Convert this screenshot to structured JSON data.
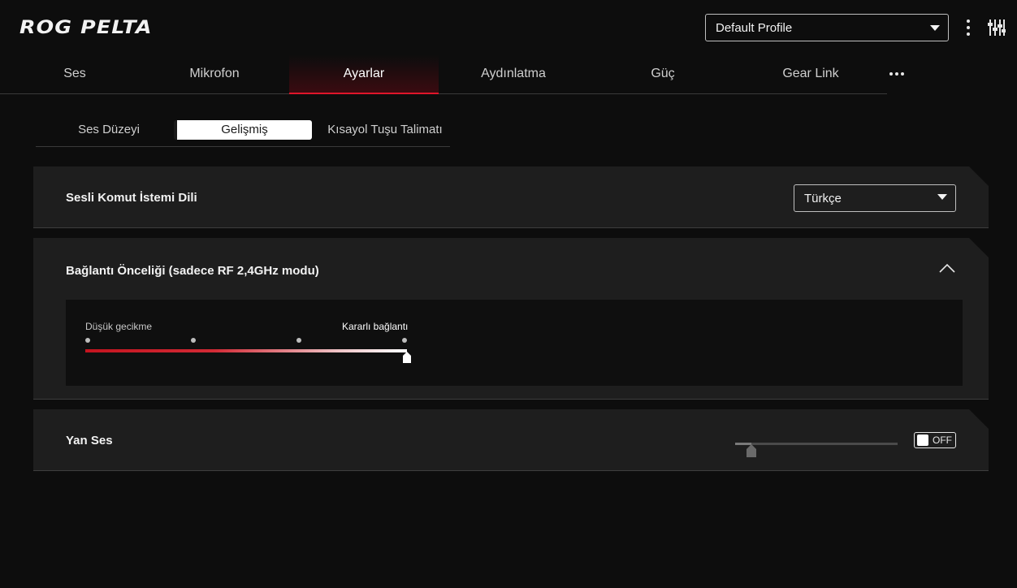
{
  "header": {
    "logo": "ROG PELTA",
    "profile": "Default Profile"
  },
  "tabs": [
    {
      "label": "Ses",
      "active": false
    },
    {
      "label": "Mikrofon",
      "active": false
    },
    {
      "label": "Ayarlar",
      "active": true
    },
    {
      "label": "Aydınlatma",
      "active": false
    },
    {
      "label": "Güç",
      "active": false
    },
    {
      "label": "Gear Link",
      "active": false
    }
  ],
  "subtabs": [
    {
      "label": "Ses Düzeyi",
      "active": false
    },
    {
      "label": "Gelişmiş",
      "active": true
    },
    {
      "label": "Kısayol Tuşu Talimatı",
      "active": false
    }
  ],
  "voice_prompt": {
    "title": "Sesli Komut İstemi Dili",
    "selected": "Türkçe"
  },
  "connection_priority": {
    "title": "Bağlantı Önceliği (sadece RF 2,4GHz modu)",
    "left_label": "Düşük gecikme",
    "right_label": "Kararlı bağlantı",
    "steps": 4,
    "selected_step": 4
  },
  "sidetone": {
    "title": "Yan Ses",
    "level": 0.1,
    "toggle_label": "OFF",
    "enabled": false
  },
  "colors": {
    "accent": "#e0152a",
    "background": "#0d0d0d",
    "card": "#1e1e1e"
  }
}
